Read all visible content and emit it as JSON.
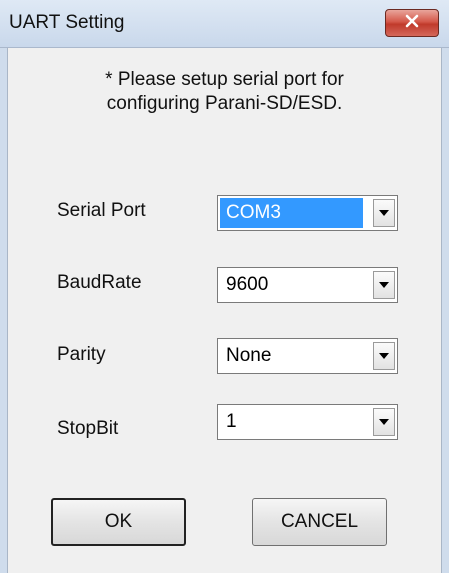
{
  "window": {
    "title": "UART Setting",
    "close_icon": "close-icon"
  },
  "message": {
    "line1": "* Please setup serial port for",
    "line2": "configuring Parani-SD/ESD."
  },
  "fields": [
    {
      "label": "Serial Port",
      "value": "COM3",
      "focused": true
    },
    {
      "label": "BaudRate",
      "value": "9600",
      "focused": false
    },
    {
      "label": "Parity",
      "value": "None",
      "focused": false
    },
    {
      "label": "StopBit",
      "value": "1",
      "focused": false
    }
  ],
  "buttons": {
    "ok": "OK",
    "cancel": "CANCEL"
  },
  "colors": {
    "selection": "#3399ff",
    "close_button": "#c9473a"
  }
}
